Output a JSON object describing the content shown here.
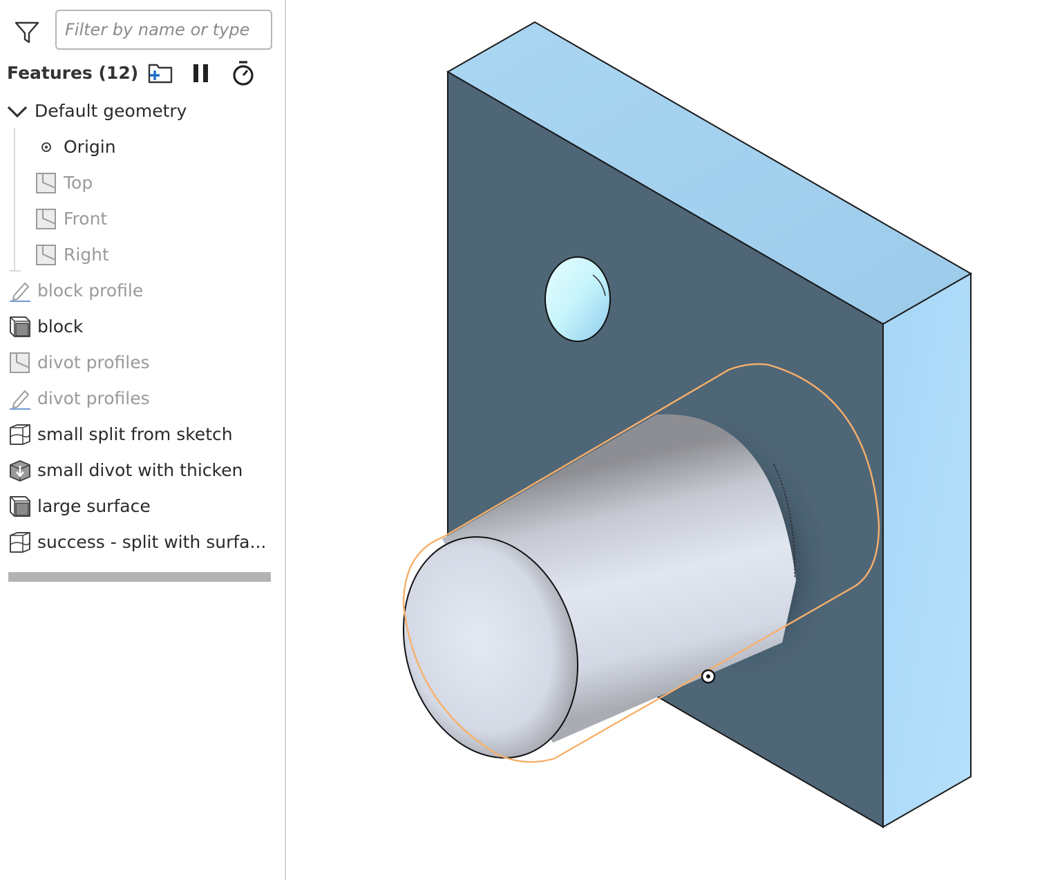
{
  "filter": {
    "placeholder": "Filter by name or type",
    "value": "",
    "icon": "filter-icon"
  },
  "features": {
    "title": "Features (12)",
    "toolbar": [
      {
        "icon": "add-folder-icon"
      },
      {
        "icon": "pause-icon"
      },
      {
        "icon": "stopwatch-icon"
      }
    ]
  },
  "tree": {
    "group": {
      "label": "Default geometry",
      "expanded": true,
      "icon": "chevron-down-icon"
    },
    "defaults": [
      {
        "label": "Origin",
        "icon": "origin-icon",
        "dimmed": false
      },
      {
        "label": "Top",
        "icon": "plane-icon",
        "dimmed": true
      },
      {
        "label": "Front",
        "icon": "plane-icon",
        "dimmed": true
      },
      {
        "label": "Right",
        "icon": "plane-icon",
        "dimmed": true
      }
    ],
    "items": [
      {
        "label": "block profile",
        "icon": "sketch-icon",
        "dimmed": true
      },
      {
        "label": "block",
        "icon": "extrude-icon",
        "dimmed": false
      },
      {
        "label": "divot profiles",
        "icon": "plane-icon",
        "dimmed": true
      },
      {
        "label": "divot profiles",
        "icon": "sketch-icon",
        "dimmed": true
      },
      {
        "label": "small split from sketch",
        "icon": "split-icon",
        "dimmed": false
      },
      {
        "label": "small divot with thicken",
        "icon": "thicken-icon",
        "dimmed": false
      },
      {
        "label": "large surface",
        "icon": "extrude-icon",
        "dimmed": false
      },
      {
        "label": "success - split with surfa...",
        "icon": "split-icon",
        "dimmed": false
      }
    ]
  },
  "colors": {
    "block_top": "#a3d0ef",
    "block_side": "#abd8f5",
    "block_front": "#4f6677",
    "selection": "#f7b06a",
    "accent": "#1e6ec8"
  }
}
